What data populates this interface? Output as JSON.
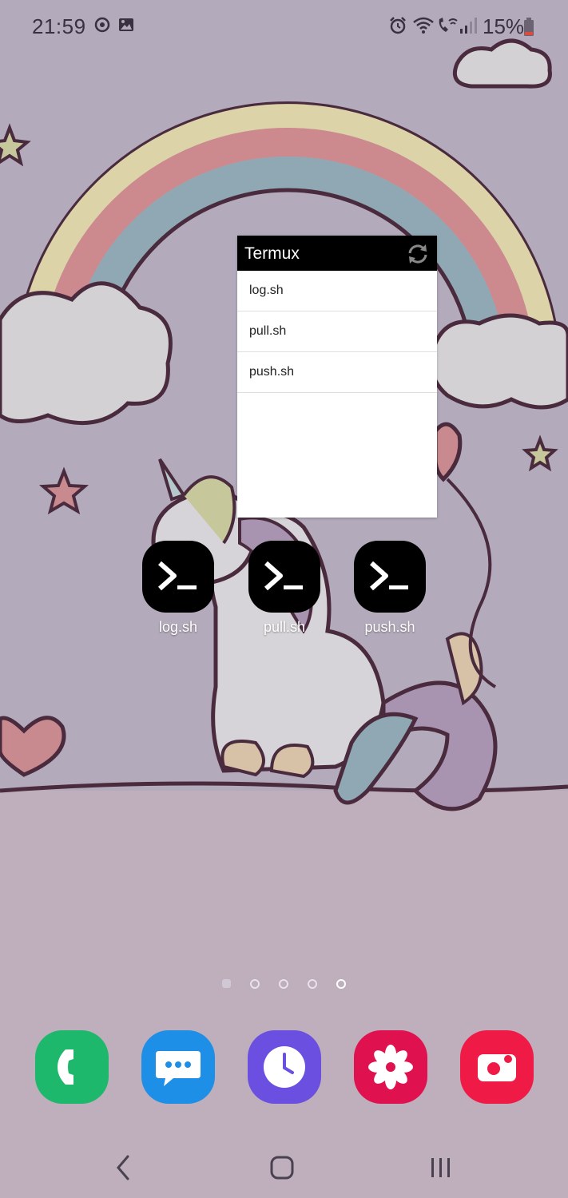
{
  "status_bar": {
    "time": "21:59",
    "battery_percent": "15%",
    "left_icons": [
      "sync-icon",
      "gallery-icon"
    ],
    "right_icons": [
      "alarm-icon",
      "wifi-icon",
      "wifi-calling-icon",
      "signal-icon",
      "battery-icon"
    ]
  },
  "widget": {
    "title": "Termux",
    "refresh_icon": "refresh-icon",
    "items": [
      {
        "label": "log.sh"
      },
      {
        "label": "pull.sh"
      },
      {
        "label": "push.sh"
      }
    ]
  },
  "shortcuts": [
    {
      "label": "log.sh",
      "icon": "terminal-icon"
    },
    {
      "label": "pull.sh",
      "icon": "terminal-icon"
    },
    {
      "label": "push.sh",
      "icon": "terminal-icon"
    }
  ],
  "page_indicator": {
    "pages": 5,
    "current": 5
  },
  "dock": [
    {
      "name": "Phone",
      "icon": "phone-icon",
      "color": "#1db86c"
    },
    {
      "name": "Messages",
      "icon": "message-icon",
      "color": "#1e8fe6"
    },
    {
      "name": "Clock",
      "icon": "clock-icon",
      "color": "#6a4fe0"
    },
    {
      "name": "Gallery",
      "icon": "flower-icon",
      "color": "#e0114f"
    },
    {
      "name": "Camera",
      "icon": "camera-icon",
      "color": "#ef1a45"
    }
  ],
  "nav_bar": {
    "buttons": [
      "back-icon",
      "home-icon",
      "recents-icon"
    ]
  }
}
